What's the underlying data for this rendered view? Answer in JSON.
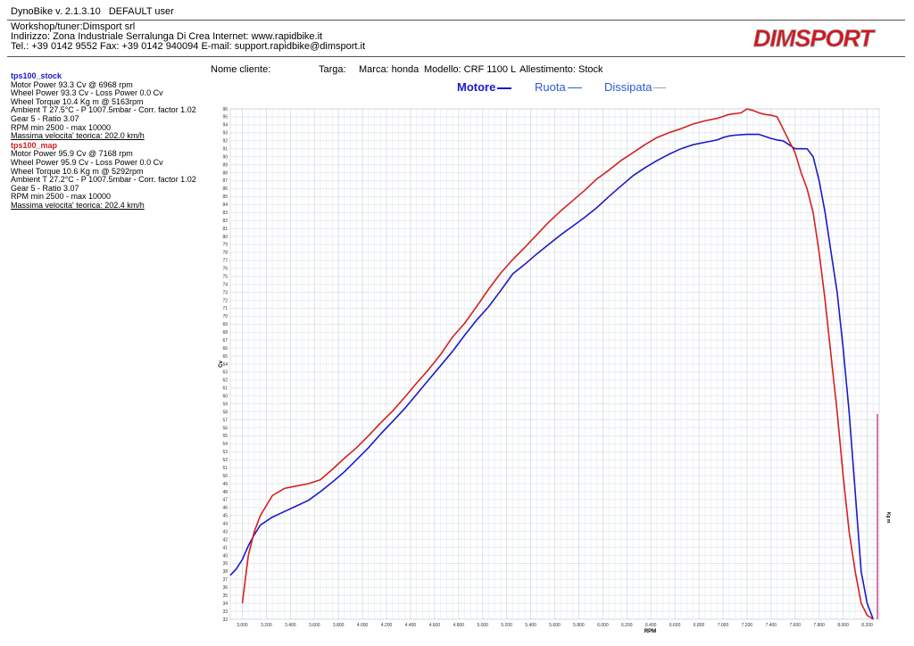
{
  "header": {
    "app_title": "DynoBike v. 2.1.3.10",
    "user": "DEFAULT user"
  },
  "workshop": {
    "line1": "Workshop/tuner:Dimsport srl",
    "line2": "Indirizzo: Zona Industriale Serralunga Di Crea Internet: www.rapidbike.it",
    "line3": "Tel.: +39 0142 9552 Fax: +39 0142 940094 E-mail: support.rapidbike@dimsport.it"
  },
  "logo": {
    "text": "DIMSPORT",
    "color": "#d8141c"
  },
  "info": {
    "cliente": "Nome cliente:",
    "targa": "Targa:",
    "marca": "Marca: honda",
    "modello": "Modello: CRF 1100 L",
    "allestimento": "Allestimento: Stock"
  },
  "legend": {
    "motore": "Motore",
    "ruota": "Ruota",
    "dissipata": "Dissipata"
  },
  "runs": [
    {
      "name": "tps100_stock",
      "color": "#1a1ac8",
      "lines": [
        "Motor Power 93.3 Cv  @ 6968 rpm",
        "Wheel Power 93.3 Cv  - Loss Power 0.0 Cv",
        "Wheel Torque 10.4 Kg m  @ 5163rpm",
        "Ambient T 27.5°C - P 1007.5mbar - Corr. factor 1.02",
        "Gear 5 - Ratio 3.07",
        "RPM min 2500 - max 10000"
      ],
      "speed": "Massima velocita' teorica: 202.0 km/h"
    },
    {
      "name": "tps100_map",
      "color": "#d42020",
      "lines": [
        "Motor Power 95.9 Cv  @ 7168 rpm",
        "Wheel Power 95.9 Cv  - Loss Power 0.0 Cv",
        "Wheel Torque 10.6 Kg m  @ 5292rpm",
        "Ambient T 27.2°C - P 1007.5mbar - Corr. factor 1.02",
        "Gear 5 - Ratio 3.07",
        "RPM min 2500 - max 10000"
      ],
      "speed": "Massima velocita' teorica: 202.4 km/h"
    }
  ],
  "chart_data": {
    "type": "line",
    "xlabel": "RPM",
    "ylabel": "Cv",
    "y2label": "Kg m",
    "xlim": [
      2900,
      8300
    ],
    "ylim": [
      32,
      96
    ],
    "xticks": [
      3000,
      3200,
      3400,
      3600,
      3800,
      4000,
      4200,
      4400,
      4600,
      4800,
      5000,
      5200,
      5400,
      5600,
      5800,
      6000,
      6200,
      6400,
      6600,
      6800,
      7000,
      7200,
      7400,
      7600,
      7800,
      8000,
      8200
    ],
    "grid": true,
    "series": [
      {
        "name": "tps100_stock",
        "color": "#1a1ac8",
        "x": [
          2900,
          2950,
          3000,
          3050,
          3100,
          3150,
          3250,
          3350,
          3450,
          3550,
          3650,
          3750,
          3850,
          3950,
          4050,
          4150,
          4250,
          4350,
          4450,
          4550,
          4650,
          4750,
          4850,
          4950,
          5050,
          5150,
          5250,
          5350,
          5450,
          5550,
          5650,
          5750,
          5850,
          5950,
          6050,
          6150,
          6250,
          6350,
          6450,
          6550,
          6650,
          6750,
          6850,
          6950,
          7000,
          7050,
          7100,
          7200,
          7300,
          7400,
          7450,
          7500,
          7550,
          7600,
          7650,
          7700,
          7750,
          7800,
          7850,
          7900,
          7950,
          8000,
          8050,
          8100,
          8150,
          8200,
          8250
        ],
        "y": [
          37.5,
          38.3,
          39.5,
          41.2,
          42.6,
          43.8,
          44.8,
          45.5,
          46.2,
          46.9,
          48.0,
          49.2,
          50.5,
          52.0,
          53.5,
          55.2,
          56.8,
          58.4,
          60.2,
          62.0,
          63.8,
          65.6,
          67.6,
          69.5,
          71.2,
          73.2,
          75.3,
          76.5,
          77.8,
          79.0,
          80.2,
          81.3,
          82.4,
          83.6,
          85.0,
          86.3,
          87.6,
          88.6,
          89.5,
          90.3,
          91.0,
          91.5,
          91.8,
          92.1,
          92.4,
          92.6,
          92.7,
          92.8,
          92.8,
          92.3,
          92.1,
          92.0,
          91.5,
          91.0,
          91.0,
          91.0,
          90.0,
          87.0,
          83.0,
          78.0,
          73.0,
          66.0,
          58.0,
          48.0,
          38.0,
          34.0,
          32.0
        ]
      },
      {
        "name": "tps100_map",
        "color": "#d42020",
        "x": [
          3000,
          3050,
          3100,
          3150,
          3250,
          3350,
          3450,
          3550,
          3650,
          3750,
          3850,
          3950,
          4050,
          4150,
          4250,
          4350,
          4450,
          4550,
          4650,
          4750,
          4850,
          4950,
          5050,
          5150,
          5250,
          5350,
          5450,
          5550,
          5650,
          5750,
          5850,
          5950,
          6050,
          6150,
          6250,
          6350,
          6450,
          6550,
          6650,
          6750,
          6850,
          6950,
          7050,
          7150,
          7200,
          7250,
          7300,
          7350,
          7400,
          7450,
          7500,
          7550,
          7600,
          7650,
          7700,
          7750,
          7800,
          7850,
          7900,
          7950,
          8000,
          8050,
          8100,
          8150,
          8200,
          8250
        ],
        "y": [
          34.0,
          40.0,
          43.0,
          45.0,
          47.5,
          48.4,
          48.7,
          49.0,
          49.5,
          50.8,
          52.2,
          53.5,
          55.0,
          56.6,
          58.1,
          59.8,
          61.6,
          63.3,
          65.2,
          67.4,
          69.1,
          71.2,
          73.4,
          75.4,
          77.1,
          78.6,
          80.2,
          81.8,
          83.2,
          84.5,
          85.8,
          87.2,
          88.3,
          89.5,
          90.5,
          91.5,
          92.4,
          93.0,
          93.5,
          94.1,
          94.5,
          94.8,
          95.3,
          95.5,
          96.0,
          95.8,
          95.5,
          95.3,
          95.2,
          95.0,
          93.5,
          92.0,
          90.5,
          88.0,
          86.0,
          83.0,
          78.0,
          72.0,
          65.0,
          58.0,
          50.0,
          43.0,
          38.0,
          34.0,
          32.5,
          32.0
        ]
      }
    ]
  }
}
